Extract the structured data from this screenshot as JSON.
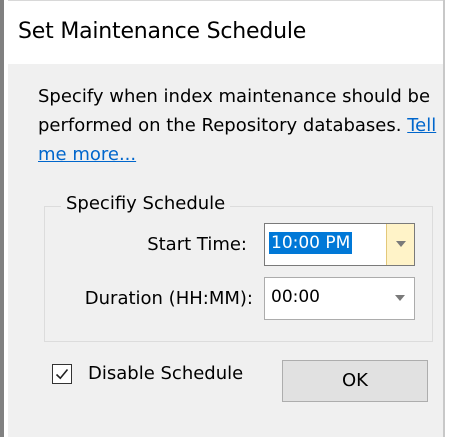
{
  "dialog": {
    "title": "Set Maintenance Schedule",
    "description_text": "Specify when index maintenance should be performed on the Repository databases.",
    "help_link_label": "Tell me more...",
    "group": {
      "title": "Specifiy Schedule",
      "start_time": {
        "label": "Start Time:",
        "value": "10:00 PM",
        "icon": "chevron-down-icon"
      },
      "duration": {
        "label": "Duration (HH:MM):",
        "value": "00:00",
        "icon": "chevron-down-icon"
      }
    },
    "disable_schedule": {
      "label": "Disable Schedule",
      "checked": true,
      "icon": "checkmark-icon"
    },
    "ok_button_label": "OK"
  },
  "colors": {
    "link": "#0066cc",
    "selection_bg": "#0078d7",
    "dialog_bg": "#f0f0f0",
    "button_bg": "#e1e1e1",
    "dropdown_hover": "#fff3c8"
  }
}
